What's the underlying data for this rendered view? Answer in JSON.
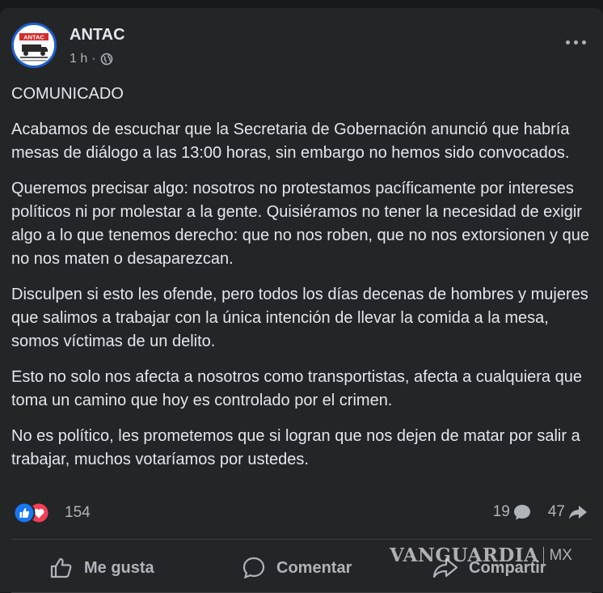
{
  "post": {
    "author": "ANTAC",
    "logo_text": "ANTAC",
    "time": "1 h",
    "separator": "·",
    "privacy_icon": "globe-icon",
    "more_icon": "more-horizontal-icon",
    "paragraphs": [
      "COMUNICADO",
      "Acabamos de escuchar que la Secretaria de Gobernación anunció que habría mesas de diálogo a las 13:00 horas, sin embargo no hemos sido convocados.",
      "Queremos precisar algo: nosotros no protestamos pacíficamente por intereses políticos ni por molestar a la gente. Quisiéramos no tener la necesidad de exigir algo a lo que tenemos derecho: que no nos roben, que no nos extorsionen y que no nos maten o desaparezcan.",
      "Disculpen si esto les ofende, pero todos los días decenas de hombres y mujeres que salimos a trabajar con la única intención de llevar la comida a la mesa, somos víctimas de un delito.",
      "Esto no solo nos afecta a nosotros como transportistas, afecta a cualquiera que toma un camino que hoy es controlado por el crimen.",
      "No es político, les prometemos que si logran que nos dejen de matar por salir a trabajar, muchos votaríamos por ustedes."
    ]
  },
  "engagement": {
    "reactions_count": "154",
    "reaction_icons": [
      "like-icon",
      "love-icon"
    ],
    "comments_count": "19",
    "shares_count": "47"
  },
  "actions": {
    "like_label": "Me gusta",
    "comment_label": "Comentar",
    "share_label": "Compartir"
  },
  "watermark": {
    "name": "VANGUARDIA",
    "country": "MX"
  },
  "colors": {
    "background": "#18191a",
    "card": "#242526",
    "text": "#e4e6eb",
    "secondary_text": "#b0b3b8",
    "like_blue": "#1877f2",
    "love_red": "#f33e58",
    "logo_red": "#d62b2b",
    "logo_ring": "#1d5fd1"
  }
}
